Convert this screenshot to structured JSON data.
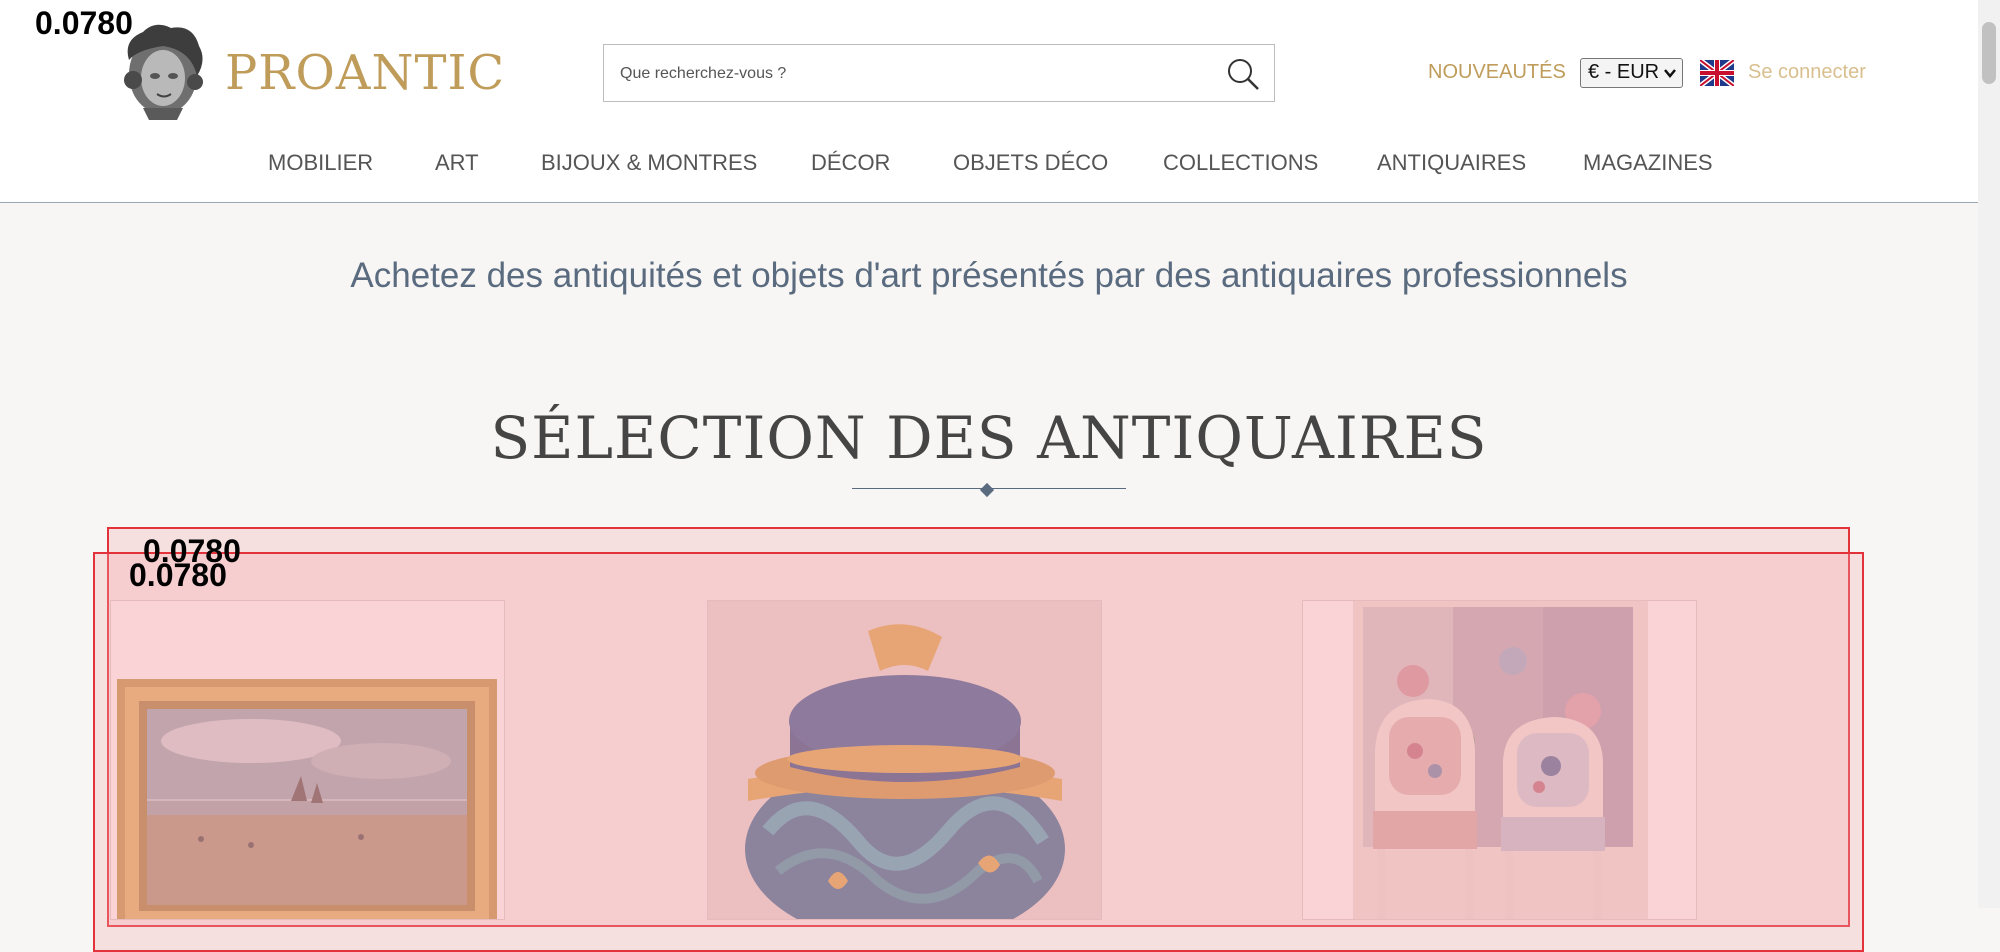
{
  "brand": {
    "name": "PROANTIC",
    "logo_icon": "marble-bust-logo"
  },
  "search": {
    "placeholder": "Que recherchez-vous ?",
    "icon": "search-icon"
  },
  "header_links": {
    "new": "NOUVEAUTÉS",
    "currency": "€ - EUR",
    "language_flag": "uk-flag-icon",
    "login": "Se connecter"
  },
  "nav": {
    "items": [
      {
        "label": "MOBILIER"
      },
      {
        "label": "ART"
      },
      {
        "label": "BIJOUX & MONTRES"
      },
      {
        "label": "DÉCOR"
      },
      {
        "label": "OBJETS DÉCO"
      },
      {
        "label": "COLLECTIONS"
      },
      {
        "label": "ANTIQUAIRES"
      },
      {
        "label": "MAGAZINES"
      }
    ]
  },
  "tagline": "Achetez des antiquités et objets d'art présentés par des antiquaires professionnels",
  "section": {
    "title": "SÉLECTION DES ANTIQUAIRES"
  },
  "overlay_scores": {
    "logo": "0.0780",
    "box1": "0.0780",
    "box2": "0.0780"
  },
  "products": [
    {
      "image": "gilt-framed-beach-landscape-painting"
    },
    {
      "image": "blue-and-gold-lidded-porcelain-box"
    },
    {
      "image": "pair-of-tapestry-armchairs-with-screen"
    }
  ],
  "colors": {
    "gold": "#bf9c5a",
    "slate": "#5a6b80",
    "highlight_border": "#e3323a",
    "page_bg": "#f7f6f4"
  }
}
